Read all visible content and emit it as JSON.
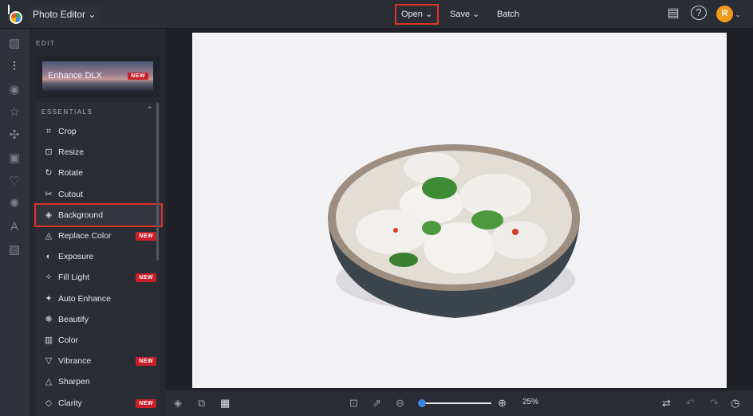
{
  "header": {
    "app_menu": "Photo Editor",
    "open": "Open",
    "save": "Save",
    "batch": "Batch",
    "avatar_initial": "R"
  },
  "panel": {
    "section": "EDIT",
    "enhance": {
      "label": "Enhance DLX",
      "badge": "NEW"
    },
    "essentials": "ESSENTIALS",
    "items": [
      {
        "label": "Crop",
        "icon": "⌗"
      },
      {
        "label": "Resize",
        "icon": "⊡"
      },
      {
        "label": "Rotate",
        "icon": "↻"
      },
      {
        "label": "Cutout",
        "icon": "✂"
      },
      {
        "label": "Background",
        "icon": "◈",
        "selected": true
      },
      {
        "label": "Replace Color",
        "icon": "◬",
        "badge": "NEW"
      },
      {
        "label": "Exposure",
        "icon": "◐"
      },
      {
        "label": "Fill Light",
        "icon": "✧",
        "badge": "NEW"
      },
      {
        "label": "Auto Enhance",
        "icon": "✦"
      },
      {
        "label": "Beautify",
        "icon": "❋"
      },
      {
        "label": "Color",
        "icon": "▥"
      },
      {
        "label": "Vibrance",
        "icon": "▽",
        "badge": "NEW"
      },
      {
        "label": "Sharpen",
        "icon": "△"
      },
      {
        "label": "Clarity",
        "icon": "◇",
        "badge": "NEW"
      }
    ]
  },
  "footer": {
    "zoom": "25%",
    "zoom_level": 25
  },
  "colors": {
    "highlight": "#e0342b",
    "accent": "#3d86e0",
    "avatar": "#f29a1e"
  }
}
